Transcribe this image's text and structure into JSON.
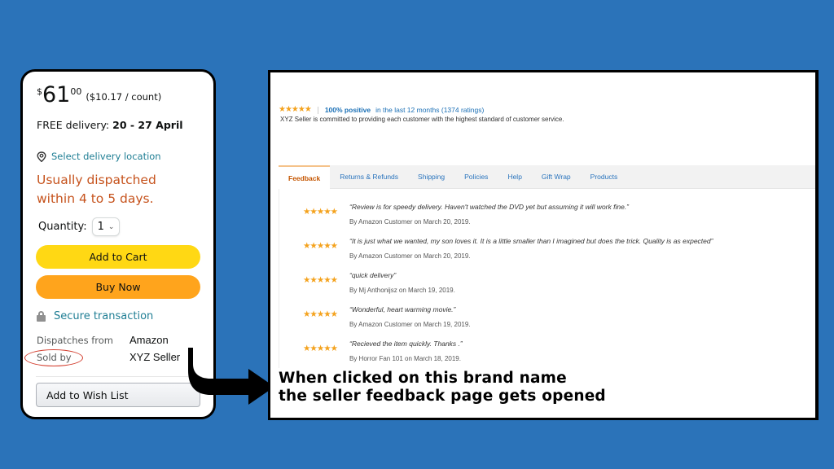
{
  "product_card": {
    "price": {
      "currency_symbol": "$",
      "whole": "61",
      "fraction": "00",
      "unit_price": "($10.17 / count)"
    },
    "delivery": {
      "label": "FREE delivery:",
      "dates": "20 - 27 April"
    },
    "location_link": "Select delivery location",
    "dispatch_note_line1": "Usually dispatched",
    "dispatch_note_line2": "within 4 to 5 days.",
    "quantity": {
      "label": "Quantity:",
      "selected": "1"
    },
    "add_to_cart_label": "Add to Cart",
    "buy_now_label": "Buy Now",
    "secure_transaction": "Secure transaction",
    "dispatches_from": {
      "label": "Dispatches from",
      "value": "Amazon"
    },
    "sold_by": {
      "label": "Sold by",
      "value": "XYZ Seller"
    },
    "add_to_wish_list_label": "Add to Wish List"
  },
  "feedback_page": {
    "summary": {
      "rating_stars": 5,
      "stars_glyph": "★★★★★",
      "positive_percent": "100% positive",
      "period": "in the last 12 months (1374 ratings)",
      "statement": "XYZ Seller is committed to providing each customer with the highest standard of customer service."
    },
    "tabs": [
      {
        "label": "Feedback",
        "active": true
      },
      {
        "label": "Returns & Refunds",
        "active": false
      },
      {
        "label": "Shipping",
        "active": false
      },
      {
        "label": "Policies",
        "active": false
      },
      {
        "label": "Help",
        "active": false
      },
      {
        "label": "Gift Wrap",
        "active": false
      },
      {
        "label": "Products",
        "active": false
      }
    ],
    "reviews": [
      {
        "stars": 5,
        "stars_glyph": "★★★★★",
        "text": "“Review is for speedy delivery. Haven't watched the DVD yet but assuming it will work fine.”",
        "byline": "By Amazon Customer on March 20, 2019."
      },
      {
        "stars": 5,
        "stars_glyph": "★★★★★",
        "text": "“It is just what we wanted, my son loves it. It is a little smaller than I imagined but does the trick. Quality is as expected”",
        "byline": "By Amazon Customer on March 20, 2019."
      },
      {
        "stars": 5,
        "stars_glyph": "★★★★★",
        "text": "“quick delivery”",
        "byline": "By Mj Anthonijsz on March 19, 2019."
      },
      {
        "stars": 5,
        "stars_glyph": "★★★★★",
        "text": "“Wonderful, heart warming movie.”",
        "byline": "By Amazon Customer on March 19, 2019."
      },
      {
        "stars": 5,
        "stars_glyph": "★★★★★",
        "text": "“Recieved the item quickly. Thanks .”",
        "byline": "By Horror Fan 101 on March 18, 2019."
      }
    ]
  },
  "annotation": {
    "line1": "When clicked on this brand name",
    "line2": "the seller feedback page gets opened"
  },
  "colors": {
    "background": "#2b73b9",
    "add_to_cart": "#ffd814",
    "buy_now": "#ffa41c",
    "dispatch_note": "#c6531d",
    "link_teal": "#1f7e94",
    "tab_link": "#2a74bd",
    "active_tab": "#c45500",
    "stars": "#f4a21d",
    "highlight_ring": "#d23a2a"
  }
}
